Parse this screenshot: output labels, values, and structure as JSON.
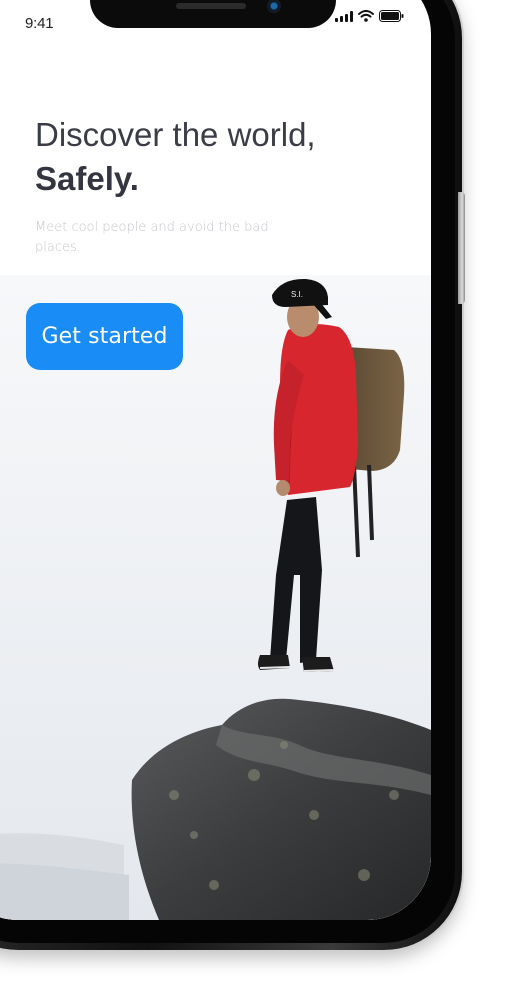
{
  "status_bar": {
    "time": "9:41",
    "icons": [
      "cellular-signal-icon",
      "wifi-icon",
      "battery-icon"
    ]
  },
  "onboarding": {
    "headline_line1": "Discover the world,",
    "headline_line2": "Safely.",
    "subtitle": "Meet cool people and avoid the bad places.",
    "cta_label": "Get started"
  },
  "colors": {
    "accent": "#1a8cf5",
    "headline": "#3a3d45",
    "subtitle": "#c6c8cc",
    "jacket": "#d8262f"
  }
}
